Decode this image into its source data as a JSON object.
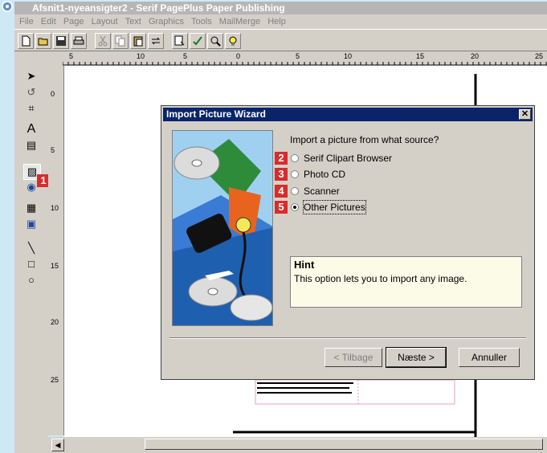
{
  "window": {
    "title": "Afsnit1-nyeansigter2 - Serif PagePlus Paper Publishing"
  },
  "menu": [
    "File",
    "Edit",
    "Page",
    "Layout",
    "Text",
    "Graphics",
    "Tools",
    "MailMerge",
    "Help"
  ],
  "toolbar": {
    "icons": [
      "new-icon",
      "open-icon",
      "save-icon",
      "print-icon",
      "cut-icon",
      "copy-icon",
      "paste-icon",
      "replace-icon",
      "zoom-tool-icon",
      "spellcheck-icon",
      "preview-icon",
      "hint-bulb-icon"
    ]
  },
  "toolbox": {
    "icons": [
      "pointer-icon",
      "rotate-icon",
      "crop-icon",
      "text-icon",
      "textframe-icon",
      "picture-icon",
      "ole-icon",
      "table-icon",
      "form-icon",
      "line-icon",
      "rectangle-icon",
      "ellipse-icon"
    ]
  },
  "ruler": {
    "labels": [
      "5",
      "10",
      "15",
      "20",
      "25"
    ],
    "vlabels": [
      "0",
      "5",
      "10",
      "15",
      "20",
      "25"
    ]
  },
  "dialog": {
    "title": "Import Picture Wizard",
    "question": "Import a picture from what source?",
    "options": [
      {
        "badge": "2",
        "label": "Serif Clipart Browser",
        "selected": false
      },
      {
        "badge": "3",
        "label": "Photo CD",
        "selected": false
      },
      {
        "badge": "4",
        "label": "Scanner",
        "selected": false
      },
      {
        "badge": "5",
        "label": "Other Pictures",
        "selected": true
      }
    ],
    "hint_title": "Hint",
    "hint_text": "This option lets you to import any image.",
    "buttons": {
      "back": "< Tilbage",
      "next": "Næste >",
      "cancel": "Annuller"
    }
  },
  "callout": {
    "badge": "1"
  },
  "colors": {
    "badge": "#d92b2b",
    "dialog_title": "#0a246a",
    "background": "#cfe8f6"
  }
}
